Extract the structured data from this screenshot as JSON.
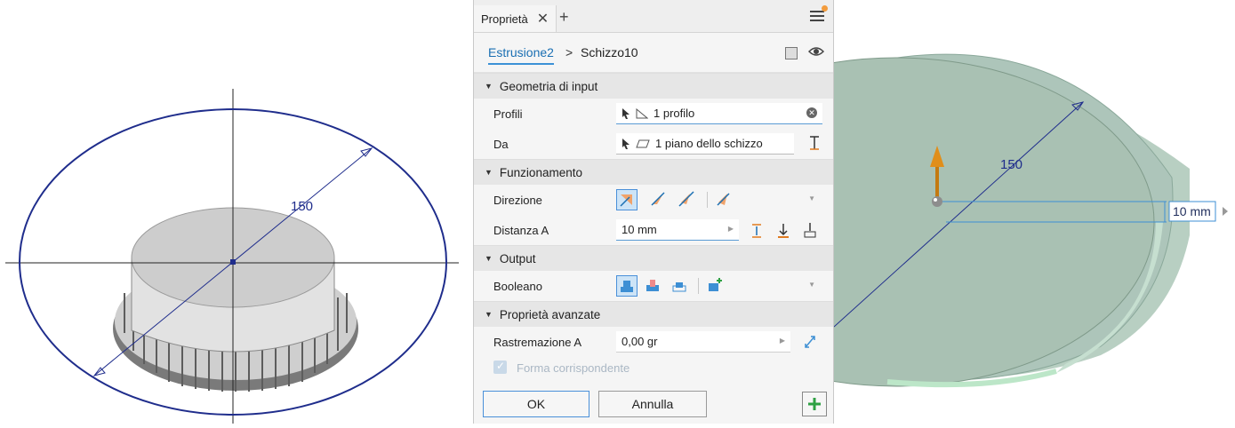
{
  "panel": {
    "tab_label": "Proprietà",
    "tab_close": "✕",
    "add_tab": "+",
    "breadcrumb": {
      "feature": "Estrusione2",
      "separator": ">",
      "sketch": "Schizzo10"
    },
    "sections": {
      "input": "Geometria di input",
      "operation": "Funzionamento",
      "output": "Output",
      "advanced": "Proprietà avanzate"
    },
    "profiles": {
      "label": "Profili",
      "value": "1 profilo"
    },
    "from": {
      "label": "Da",
      "value": "1 piano dello schizzo"
    },
    "direction": {
      "label": "Direzione"
    },
    "distance": {
      "label": "Distanza A",
      "value": "10 mm"
    },
    "boolean": {
      "label": "Booleano"
    },
    "taper": {
      "label": "Rastremazione A",
      "value": "0,00 gr"
    },
    "match_shape": {
      "label": "Forma corrispondente",
      "checked": true
    },
    "buttons": {
      "ok": "OK",
      "cancel": "Annulla",
      "add": "+"
    }
  },
  "viewport_left": {
    "dimension": "150"
  },
  "viewport_right": {
    "dimension": "150",
    "distance_input": "10 mm"
  },
  "colors": {
    "accent": "#3c91d6",
    "add_green": "#2ea043",
    "orange": "#f39c3d",
    "arrow": "#d08a1c"
  }
}
